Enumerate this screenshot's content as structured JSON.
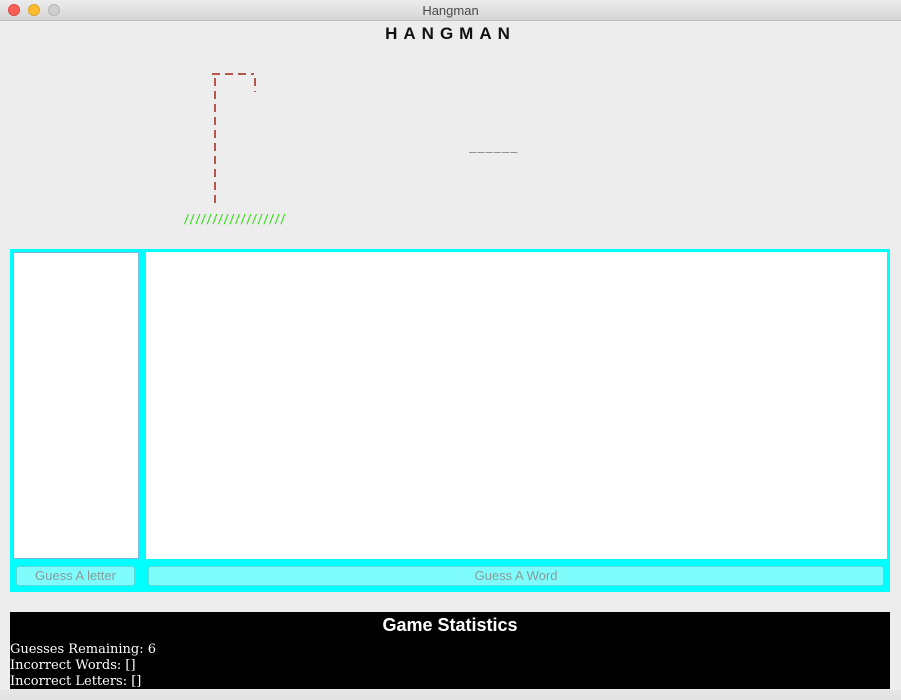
{
  "window": {
    "title": "Hangman"
  },
  "game": {
    "heading": "HANGMAN",
    "word_blanks": "______",
    "ground_pattern": "//////////////////",
    "colors": {
      "gallows": "#b5564a",
      "ground": "#22dd00",
      "panel": "#00ffff",
      "button": "#7ffcfc"
    }
  },
  "controls": {
    "guess_letter_label": "Guess A letter",
    "guess_word_label": "Guess A Word",
    "letter_input_value": "",
    "word_input_value": ""
  },
  "stats": {
    "title": "Game Statistics",
    "guesses_remaining_line": "Guesses Remaining: 6",
    "incorrect_words_line": "Incorrect Words: []",
    "incorrect_letters_line": "Incorrect Letters: []"
  }
}
